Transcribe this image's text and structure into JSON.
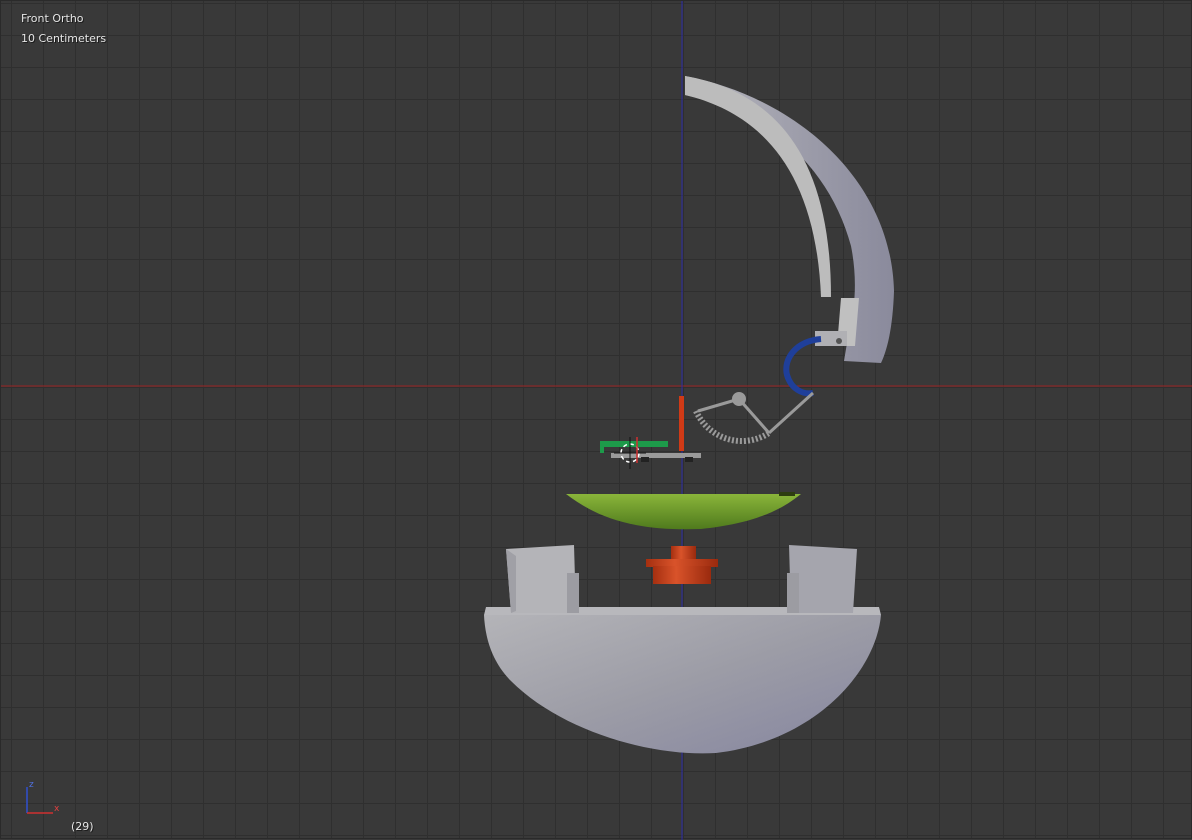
{
  "viewport": {
    "view_name": "Front Ortho",
    "grid_scale": "10 Centimeters",
    "frame": "(29)"
  },
  "axes": {
    "x_label": "x",
    "z_label": "z",
    "x_color": "#d03030",
    "z_color": "#3050d0"
  },
  "colors": {
    "background": "#393939",
    "grid_line": "#2f2f2f",
    "x_axis_line": "#a02020",
    "z_axis_line": "#2020a0",
    "shell_gray": "#a6a6ae",
    "plate_green": "#6a9a2c",
    "spring_blue": "#1f3f9a",
    "part_red": "#c3411b",
    "gear_gray": "#9a9a9a",
    "lever_green": "#1d9a4a"
  }
}
